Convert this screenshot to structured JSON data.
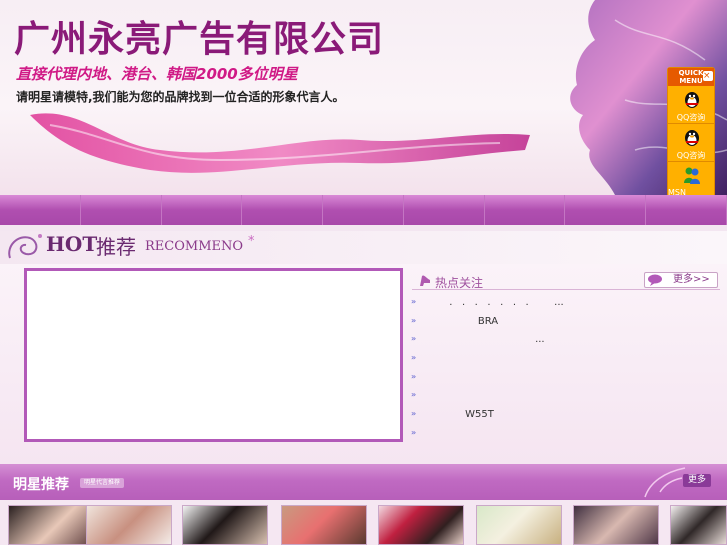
{
  "header": {
    "company_name": "广州永亮广告有限公司",
    "tagline": "直接代理内地、港台、韩国2000多位明星",
    "subtagline": "请明星请模特,我们能为您的品牌找到一位合适的形象代言人。"
  },
  "quick_menu": {
    "title": "QUICK MENU",
    "close": "×",
    "items": [
      {
        "label": "QQ咨询",
        "icon": "qq-penguin-icon"
      },
      {
        "label": "QQ咨询",
        "icon": "qq-penguin-icon"
      },
      {
        "label": "MSN",
        "icon": "msn-icon"
      }
    ]
  },
  "hot": {
    "title_en": "HOT",
    "title_cn": "推荐",
    "subtitle": "RECOMMENO",
    "star": "*"
  },
  "news": {
    "title": "热点关注",
    "more_label": "更多>>",
    "bullet": "»",
    "items": [
      "       .   .   .   .   .   .   .        ...",
      "                BRA",
      "                                  ...",
      "",
      "",
      "",
      "            W55T",
      ""
    ]
  },
  "stars": {
    "title": "明星推荐",
    "subtitle": "明星代言推荐",
    "more_label": "更多"
  },
  "colors": {
    "brand_purple": "#8a1a78",
    "accent_pink": "#d01a86",
    "nav_purple": "#b04fb0",
    "quick_menu_orange": "#ffb000"
  }
}
